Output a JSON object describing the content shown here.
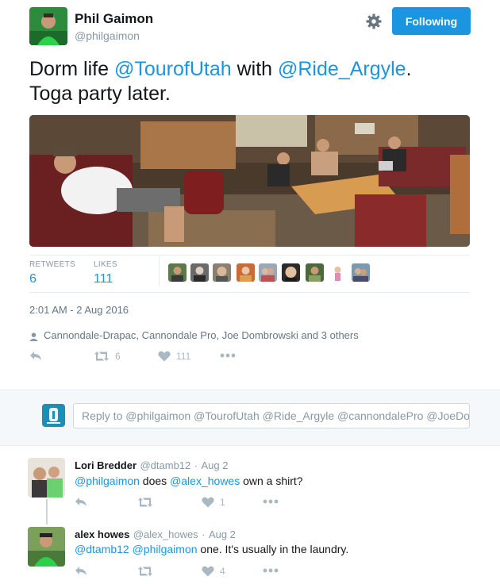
{
  "header": {
    "name": "Phil Gaimon",
    "handle": "@philgaimon",
    "follow_label": "Following",
    "settings_icon": "gear-icon"
  },
  "tweet": {
    "text_1": "Dorm life ",
    "mention_1": "@TourofUtah",
    "text_2": " with ",
    "mention_2": "@Ride_Argyle",
    "text_3": ".",
    "text_4": "Toga party later."
  },
  "stats": {
    "retweets_label": "RETWEETS",
    "retweets": "6",
    "likes_label": "LIKES",
    "likes": "111"
  },
  "timestamp": "2:01 AM - 2 Aug 2016",
  "tagged": "Cannondale-Drapac, Cannondale Pro, Joe Dombrowski and 3 others",
  "actions": {
    "retweet_count": "6",
    "like_count": "111"
  },
  "reply_box": {
    "placeholder": "Reply to @philgaimon @TourofUtah @Ride_Argyle @cannondalePro @JoeDo"
  },
  "replies": [
    {
      "name": "Lori Bredder",
      "handle": "@dtamb12",
      "sep": "·",
      "date": "Aug 2",
      "mention_1": "@philgaimon",
      "text_1": " does ",
      "mention_2": "@alex_howes",
      "text_2": " own a shirt?",
      "like_count": "1"
    },
    {
      "name": "alex howes",
      "handle": "@alex_howes",
      "sep": "·",
      "date": "Aug 2",
      "mention_1": "@dtamb12",
      "text_1": " ",
      "mention_2": "@philgaimon",
      "text_2": " one. It's usually in the laundry.",
      "like_count": "4"
    }
  ],
  "colors": {
    "accent": "#1b95e0",
    "muted": "#8899a6",
    "text": "#14171a",
    "band": "#f5f8fa"
  }
}
